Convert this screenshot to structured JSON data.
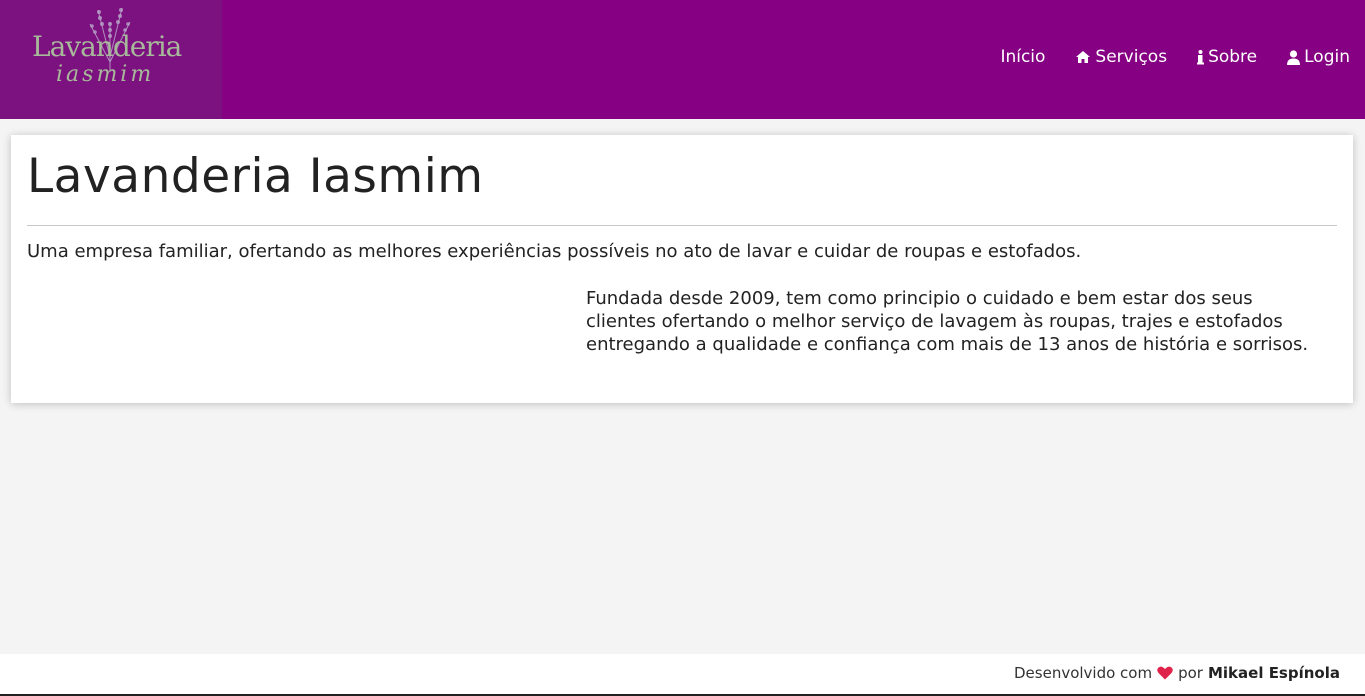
{
  "brand": {
    "logo_title": "Lavanderia",
    "logo_subtitle": "iasmim"
  },
  "nav": {
    "items": [
      {
        "label": "Início",
        "icon": ""
      },
      {
        "label": "Serviços",
        "icon": "home-icon"
      },
      {
        "label": "Sobre",
        "icon": "info-icon"
      },
      {
        "label": "Login",
        "icon": "user-icon"
      }
    ]
  },
  "main": {
    "title": "Lavanderia Iasmim",
    "lead": "Uma empresa familiar, ofertando as melhores experiências possíveis no ato de lavar e cuidar de roupas e estofados.",
    "description": "Fundada desde 2009, tem como principio o cuidado e bem estar dos seus clientes ofertando o melhor serviço de lavagem às roupas, trajes e estofados entregando a qualidade e confiança com mais de 13 anos de história e sorrisos."
  },
  "footer": {
    "prefix": "Desenvolvido com",
    "middle": "por",
    "author": "Mikael Espínola",
    "heart_icon": "heart-icon"
  },
  "colors": {
    "navbar": "#850083",
    "logo_bg": "#7c1180",
    "logo_text": "#a8b89a",
    "heart": "#e0234a",
    "page_bg": "#f4f4f4"
  }
}
